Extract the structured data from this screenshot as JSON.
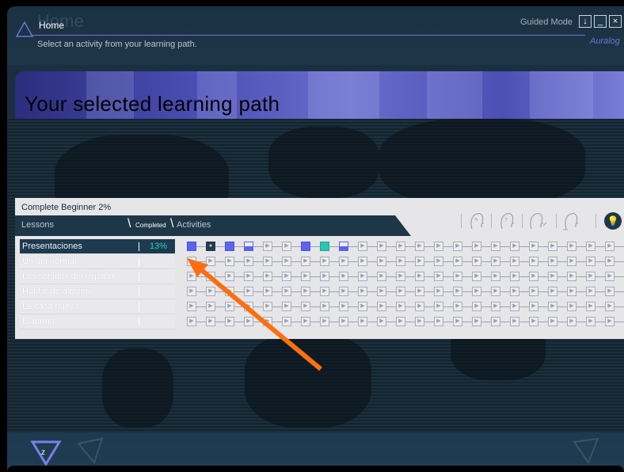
{
  "header": {
    "title": "Home",
    "subtitle": "Select an activity from your learning path.",
    "mode_label": "Guided Mode",
    "buttons": [
      "↓",
      "_",
      "×"
    ],
    "brand": "Auralog"
  },
  "banner": {
    "title": "Your selected learning path"
  },
  "path": {
    "name": "Complete Beginner 2%",
    "lessons_label": "Lessons",
    "completed_label": "Completed",
    "activities_label": "Activities",
    "activity_icons": [
      "head-listen-icon",
      "head-think-icon",
      "head-speak-icon",
      "head-write-icon",
      "bulb-icon"
    ]
  },
  "lessons": [
    {
      "name": "Presentaciones",
      "progress": "13%",
      "active": true
    },
    {
      "name": "Un dia normal",
      "progress": "",
      "active": false
    },
    {
      "name": "Los sonidos del español",
      "progress": "",
      "active": false
    },
    {
      "name": "Hablar de alguien",
      "progress": "",
      "active": false
    },
    {
      "name": "La casa nueva",
      "progress": "",
      "active": false
    },
    {
      "name": "El barrio",
      "progress": "",
      "active": false
    }
  ],
  "activity_states_first_row": [
    "done",
    "dark",
    "done",
    "half",
    "todo",
    "todo",
    "done",
    "teal",
    "half",
    "todo",
    "todo",
    "todo",
    "todo",
    "todo",
    "todo",
    "todo",
    "todo",
    "todo",
    "todo",
    "todo",
    "todo",
    "todo",
    "todo"
  ],
  "colors": {
    "accent": "#5b63f0",
    "teal": "#2cc4b4",
    "arrow": "#ff6f10",
    "panel": "#1e3748"
  }
}
